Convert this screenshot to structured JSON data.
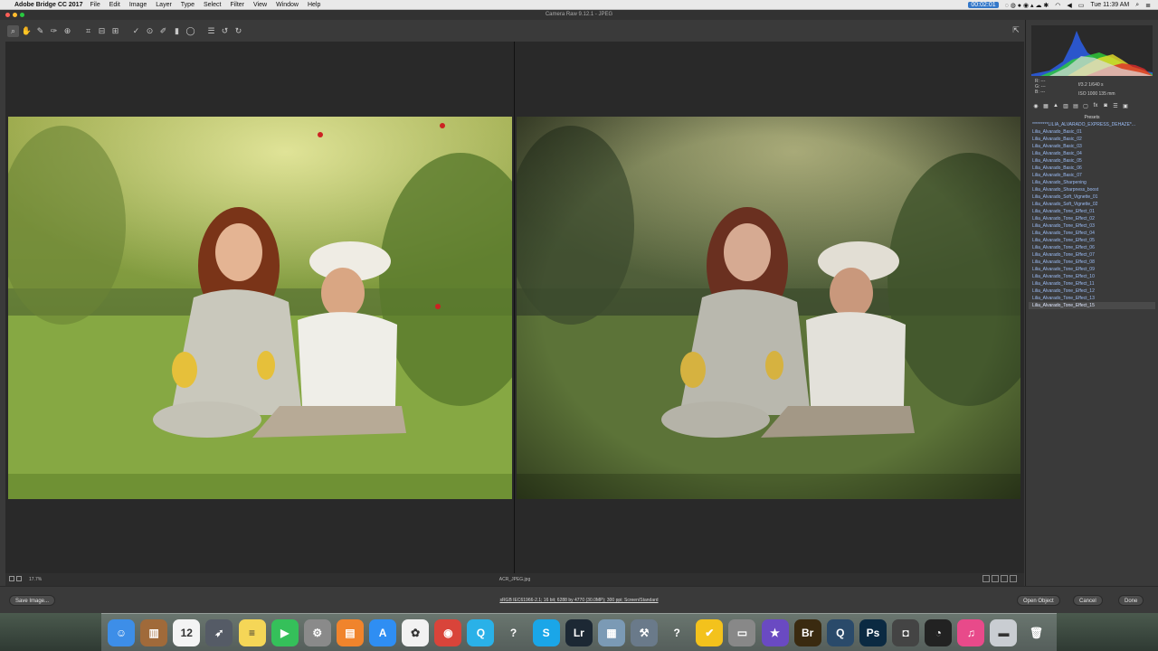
{
  "menubar": {
    "app_name": "Adobe Bridge CC 2017",
    "menus": [
      "File",
      "Edit",
      "Image",
      "Layer",
      "Type",
      "Select",
      "Filter",
      "View",
      "Window",
      "Help"
    ],
    "timer": "00:02:01",
    "clock": "Tue 11:39 AM"
  },
  "window": {
    "title": "Camera Raw 9.12.1  -  JPEG"
  },
  "camera_info": {
    "r": "R:  ---",
    "g": "G:  ---",
    "b": "B:  ---",
    "aperture_shutter": "f/3.2    1/640 s",
    "iso_lens": "ISO 1000    135 mm"
  },
  "presets": {
    "header": "Presets",
    "items": [
      "*********LILIA_ALVARADO_EXPRESS_DEHAZE*...",
      "Lilia_Alvarado_Basic_01",
      "Lilia_Alvarado_Basic_02",
      "Lilia_Alvarado_Basic_03",
      "Lilia_Alvarado_Basic_04",
      "Lilia_Alvarado_Basic_05",
      "Lilia_Alvarado_Basic_06",
      "Lilia_Alvarado_Basic_07",
      "Lilia_Alvarado_Sharpening",
      "Lilia_Alvarado_Sharpness_boost",
      "Lilia_Alvarado_Soft_Vignette_01",
      "Lilia_Alvarado_Soft_Vignette_02",
      "Lilia_Alvarado_Tone_Effect_01",
      "Lilia_Alvarado_Tone_Effect_02",
      "Lilia_Alvarado_Tone_Effect_03",
      "Lilia_Alvarado_Tone_Effect_04",
      "Lilia_Alvarado_Tone_Effect_05",
      "Lilia_Alvarado_Tone_Effect_06",
      "Lilia_Alvarado_Tone_Effect_07",
      "Lilia_Alvarado_Tone_Effect_08",
      "Lilia_Alvarado_Tone_Effect_09",
      "Lilia_Alvarado_Tone_Effect_10",
      "Lilia_Alvarado_Tone_Effect_11",
      "Lilia_Alvarado_Tone_Effect_12",
      "Lilia_Alvarado_Tone_Effect_13",
      "Lilia_Alvarado_Tone_Effect_15"
    ],
    "selected": "Lilia_Alvarado_Tone_Effect_15"
  },
  "status": {
    "zoom": "17.7%",
    "filename": "ACR_JPEG.jpg"
  },
  "bottom": {
    "save_label": "Save Image...",
    "workflow": "sRGB IEC61966-2.1; 16 bit; 6288 by 4770 (30.0MP); 300 ppi; Screen/Standard",
    "open_label": "Open Object",
    "cancel_label": "Cancel",
    "done_label": "Done"
  },
  "dock": {
    "apps": [
      {
        "name": "finder",
        "glyph": "☺",
        "color": "#3d8ee8"
      },
      {
        "name": "books-shelf",
        "glyph": "▥",
        "color": "#a06a3a"
      },
      {
        "name": "calendar",
        "glyph": "12",
        "color": "#f4f4f4"
      },
      {
        "name": "launchpad",
        "glyph": "➶",
        "color": "#555b66"
      },
      {
        "name": "notes",
        "glyph": "≡",
        "color": "#f5d657"
      },
      {
        "name": "facetime",
        "glyph": "▶",
        "color": "#35c05a"
      },
      {
        "name": "system-preferences",
        "glyph": "⚙",
        "color": "#8a8a8a"
      },
      {
        "name": "ibooks",
        "glyph": "▤",
        "color": "#f0842c"
      },
      {
        "name": "app-store",
        "glyph": "A",
        "color": "#2f8ef3"
      },
      {
        "name": "photos",
        "glyph": "✿",
        "color": "#f2f2f2"
      },
      {
        "name": "chrome",
        "glyph": "◉",
        "color": "#d9443a"
      },
      {
        "name": "quicktime",
        "glyph": "Q",
        "color": "#2ab1e8"
      },
      {
        "name": "unknown-app-1",
        "glyph": "?",
        "color": "transparent"
      },
      {
        "name": "skype",
        "glyph": "S",
        "color": "#1aa6e8"
      },
      {
        "name": "lightroom",
        "glyph": "Lr",
        "color": "#1c2834"
      },
      {
        "name": "preview",
        "glyph": "▦",
        "color": "#7b9ab5"
      },
      {
        "name": "xcode-tools",
        "glyph": "⚒",
        "color": "#6a7a8a"
      },
      {
        "name": "unknown-app-2",
        "glyph": "?",
        "color": "transparent"
      },
      {
        "name": "norton",
        "glyph": "✔",
        "color": "#f3c21c"
      },
      {
        "name": "printer",
        "glyph": "▭",
        "color": "#888"
      },
      {
        "name": "imovie",
        "glyph": "★",
        "color": "#6a4ac2"
      },
      {
        "name": "bridge",
        "glyph": "Br",
        "color": "#3a2a10"
      },
      {
        "name": "quicktime-player",
        "glyph": "Q",
        "color": "#2a4a6a"
      },
      {
        "name": "photoshop",
        "glyph": "Ps",
        "color": "#0b2a42"
      },
      {
        "name": "screenshot",
        "glyph": "◘",
        "color": "#444"
      },
      {
        "name": "clock",
        "glyph": "◔",
        "color": "#222"
      },
      {
        "name": "itunes",
        "glyph": "♫",
        "color": "#e84a8a"
      },
      {
        "name": "documents-folder",
        "glyph": "▬",
        "color": "#c9cdd2"
      },
      {
        "name": "trash",
        "glyph": "🗑",
        "color": "transparent"
      }
    ]
  }
}
